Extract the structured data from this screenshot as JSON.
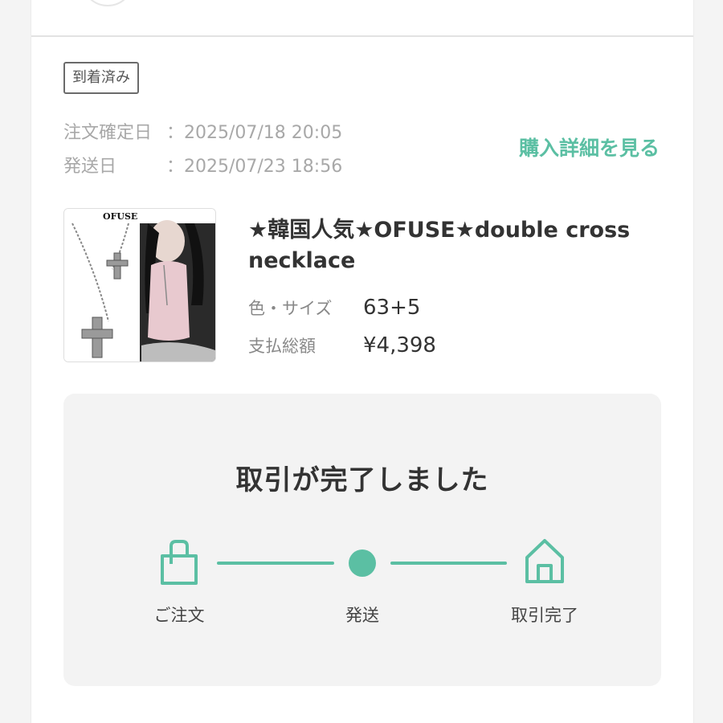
{
  "order": {
    "status_badge": "到着済み",
    "order_confirmed_label": "注文確定日",
    "order_confirmed_value": "：2025/07/18 20:05",
    "shipped_label": "発送日",
    "shipped_value": "：2025/07/23 18:56",
    "detail_link": "購入詳細を見る"
  },
  "product": {
    "thumbnail_brand": "OFUSE",
    "name": "★韓国人気★OFUSE★double cross necklace",
    "color_size_label": "色・サイズ",
    "color_size_value": "63+5",
    "total_label": "支払総額",
    "total_value": "¥4,398"
  },
  "progress": {
    "title": "取引が完了しました",
    "steps": [
      {
        "label": "ご注文",
        "icon": "shopping-bag-icon"
      },
      {
        "label": "発送",
        "icon": "dot"
      },
      {
        "label": "取引完了",
        "icon": "home-icon"
      }
    ]
  },
  "colors": {
    "accent": "#5bbfa3",
    "text": "#333333",
    "muted": "#a8a8a8"
  }
}
